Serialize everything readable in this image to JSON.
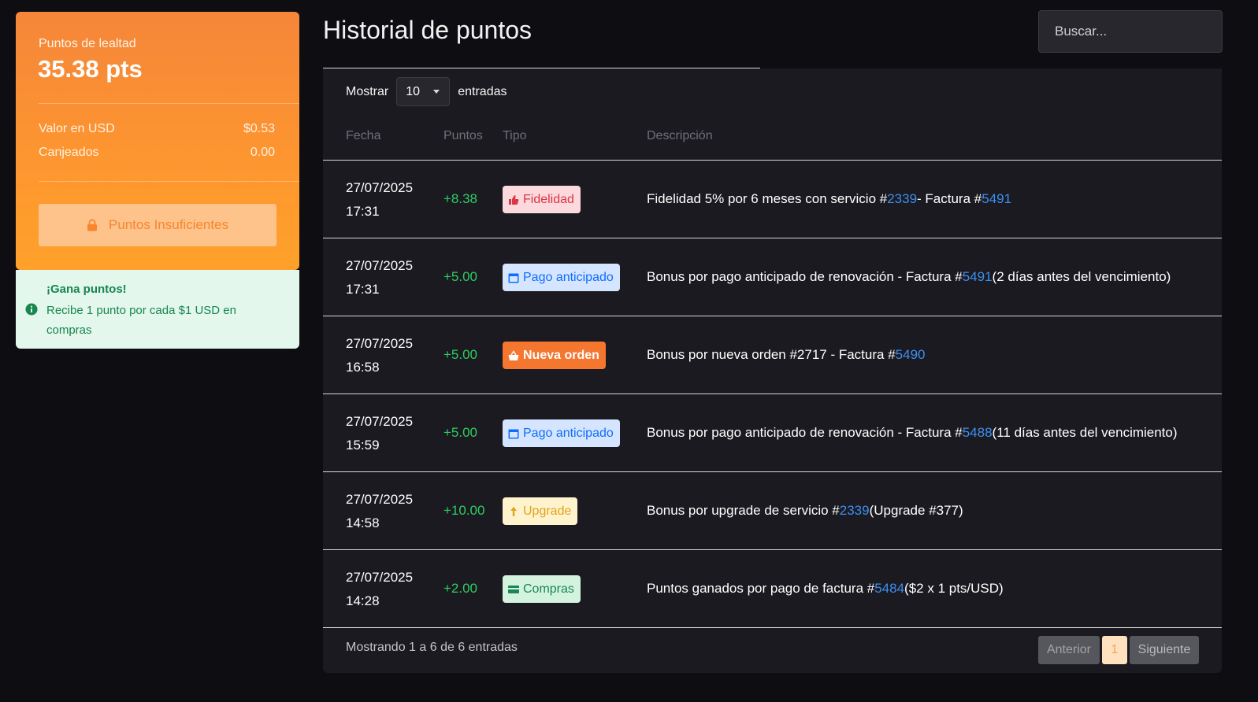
{
  "loyalty": {
    "label": "Puntos de lealtad",
    "points": "35.38 pts",
    "rows": [
      {
        "label": "Valor en USD",
        "value": "$0.53"
      },
      {
        "label": "Canjeados",
        "value": "0.00"
      }
    ],
    "button_label": "Puntos Insuficientes"
  },
  "earn": {
    "title": "¡Gana puntos!",
    "text": "Recibe 1 punto por cada $1 USD en compras"
  },
  "header": {
    "title": "Historial de puntos",
    "search_placeholder": "Buscar..."
  },
  "table": {
    "length_prefix": "Mostrar",
    "length_value": "10",
    "length_suffix": "entradas",
    "columns": [
      "Fecha",
      "Puntos",
      "Tipo",
      "Descripción"
    ],
    "rows": [
      {
        "date": "27/07/2025",
        "time": "17:31",
        "points": "+8.38",
        "type": {
          "label": "Fidelidad",
          "icon": "thumbs-up-icon",
          "bg": "#fcd9dc",
          "fg": "#dc3545"
        },
        "desc": [
          "Fidelidad 5% por 6 meses con servicio #",
          "2339",
          " - Factura #",
          "5491",
          ""
        ]
      },
      {
        "date": "27/07/2025",
        "time": "17:31",
        "points": "+5.00",
        "type": {
          "label": "Pago anticipado",
          "icon": "calendar-icon",
          "bg": "#d6e5ff",
          "fg": "#0d6efd"
        },
        "desc": [
          "Bonus por pago anticipado de renovación - Factura #",
          "5491",
          " (2 días antes del vencimiento)"
        ]
      },
      {
        "date": "27/07/2025",
        "time": "16:58",
        "points": "+5.00",
        "type": {
          "label": "Nueva orden",
          "icon": "basket-icon",
          "bg": "#f5762f",
          "fg": "#ffffff"
        },
        "desc": [
          "Bonus por nueva orden #2717 - Factura #",
          "5490",
          ""
        ]
      },
      {
        "date": "27/07/2025",
        "time": "15:59",
        "points": "+5.00",
        "type": {
          "label": "Pago anticipado",
          "icon": "calendar-icon",
          "bg": "#d6e5ff",
          "fg": "#0d6efd"
        },
        "desc": [
          "Bonus por pago anticipado de renovación - Factura #",
          "5488",
          " (11 días antes del vencimiento)"
        ]
      },
      {
        "date": "27/07/2025",
        "time": "14:58",
        "points": "+10.00",
        "type": {
          "label": "Upgrade",
          "icon": "arrow-up-icon",
          "bg": "#fff3cd",
          "fg": "#e0a31b"
        },
        "desc": [
          "Bonus por upgrade de servicio #",
          "2339",
          " (Upgrade #377)"
        ]
      },
      {
        "date": "27/07/2025",
        "time": "14:28",
        "points": "+2.00",
        "type": {
          "label": "Compras",
          "icon": "credit-card-icon",
          "bg": "#d4f3df",
          "fg": "#198754"
        },
        "desc": [
          "Puntos ganados por pago de factura #",
          "5484",
          " ($2 x 1 pts/USD)"
        ]
      }
    ],
    "info": "Mostrando 1 a 6 de 6 entradas",
    "pagination": {
      "prev": "Anterior",
      "current": "1",
      "next": "Siguiente"
    }
  }
}
